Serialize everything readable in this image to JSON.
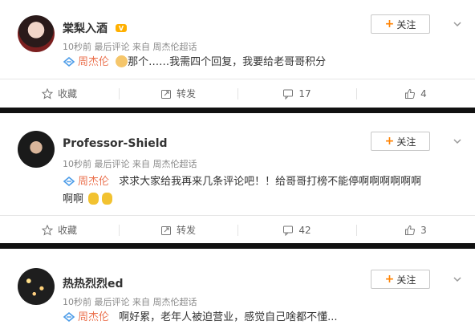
{
  "posts": [
    {
      "name": "棠梨入酒",
      "meta": "10秒前 最后评论 来自 周杰伦超话",
      "follow_label": "关注",
      "mention": "周杰伦",
      "text": "那个……我需四个回复，我要给老哥哥积分",
      "actions": {
        "favorite": "收藏",
        "forward": "转发",
        "comments": "17",
        "likes": "4"
      }
    },
    {
      "name": "Professor-Shield",
      "meta": "10秒前 最后评论 来自 周杰伦超话",
      "follow_label": "关注",
      "mention": "周杰伦",
      "text_line1": "求求大家给我再来几条评论吧！！给哥哥打榜不能停啊啊啊啊啊啊",
      "text_line2": "啊啊",
      "actions": {
        "favorite": "收藏",
        "forward": "转发",
        "comments": "42",
        "likes": "3"
      }
    },
    {
      "name": "热热烈烈ed",
      "meta": "10秒前 最后评论 来自 周杰伦超话",
      "follow_label": "关注",
      "mention": "周杰伦",
      "text": "啊好累，老年人被迫营业，感觉自己啥都不懂..."
    }
  ],
  "colors": {
    "accent": "#ff8200",
    "mention": "#eb7350",
    "separator": "#111111"
  }
}
